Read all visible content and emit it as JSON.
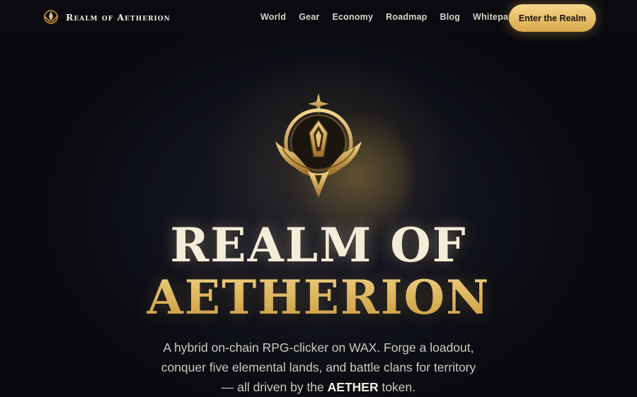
{
  "nav": {
    "brand": "Realm of Aetherion",
    "links": [
      "World",
      "Gear",
      "Economy",
      "Roadmap",
      "Blog",
      "Whitepaper"
    ],
    "cta": "Enter the Realm"
  },
  "hero": {
    "title_line1": "REALM OF",
    "title_line2": "AETHERION",
    "desc_before": "A hybrid on-chain RPG-clicker on WAX. Forge a loadout, conquer five elemental lands, and battle clans for territory — all driven by the ",
    "desc_token": "AETHER",
    "desc_after": " token."
  },
  "colors": {
    "accent": "#d9a94d",
    "background": "#0b0d14"
  }
}
